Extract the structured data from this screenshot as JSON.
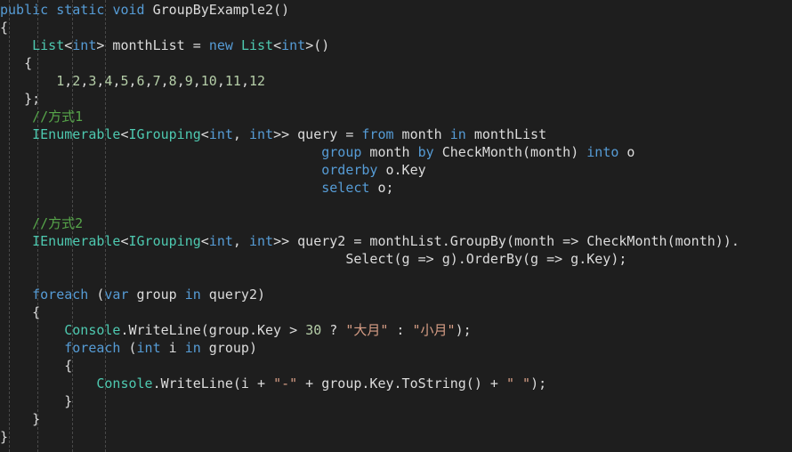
{
  "editor": {
    "background": "#1e1e1e",
    "font_size_px": 15,
    "line_height_px": 20,
    "indent_guide_color": "#5a5a5a",
    "colors": {
      "keyword": "#569cd6",
      "type": "#4ec9b0",
      "plain": "#dcdcdc",
      "number": "#b5cea8",
      "string": "#d69d85",
      "comment": "#57a64a"
    },
    "language": "csharp"
  },
  "code": {
    "lines": [
      [
        {
          "t": "public",
          "c": "kw"
        },
        {
          "t": " ",
          "c": "pln"
        },
        {
          "t": "static",
          "c": "kw"
        },
        {
          "t": " ",
          "c": "pln"
        },
        {
          "t": "void",
          "c": "kw"
        },
        {
          "t": " GroupByExample2()",
          "c": "pln"
        }
      ],
      [
        {
          "t": "{",
          "c": "pln"
        }
      ],
      [
        {
          "t": "    ",
          "c": "pln"
        },
        {
          "t": "List",
          "c": "typ"
        },
        {
          "t": "<",
          "c": "pln"
        },
        {
          "t": "int",
          "c": "kw"
        },
        {
          "t": "> monthList = ",
          "c": "pln"
        },
        {
          "t": "new",
          "c": "kw"
        },
        {
          "t": " ",
          "c": "pln"
        },
        {
          "t": "List",
          "c": "typ"
        },
        {
          "t": "<",
          "c": "pln"
        },
        {
          "t": "int",
          "c": "kw"
        },
        {
          "t": ">()",
          "c": "pln"
        }
      ],
      [
        {
          "t": "   {",
          "c": "pln"
        }
      ],
      [
        {
          "t": "       ",
          "c": "pln"
        },
        {
          "t": "1",
          "c": "num"
        },
        {
          "t": ",",
          "c": "pln"
        },
        {
          "t": "2",
          "c": "num"
        },
        {
          "t": ",",
          "c": "pln"
        },
        {
          "t": "3",
          "c": "num"
        },
        {
          "t": ",",
          "c": "pln"
        },
        {
          "t": "4",
          "c": "num"
        },
        {
          "t": ",",
          "c": "pln"
        },
        {
          "t": "5",
          "c": "num"
        },
        {
          "t": ",",
          "c": "pln"
        },
        {
          "t": "6",
          "c": "num"
        },
        {
          "t": ",",
          "c": "pln"
        },
        {
          "t": "7",
          "c": "num"
        },
        {
          "t": ",",
          "c": "pln"
        },
        {
          "t": "8",
          "c": "num"
        },
        {
          "t": ",",
          "c": "pln"
        },
        {
          "t": "9",
          "c": "num"
        },
        {
          "t": ",",
          "c": "pln"
        },
        {
          "t": "10",
          "c": "num"
        },
        {
          "t": ",",
          "c": "pln"
        },
        {
          "t": "11",
          "c": "num"
        },
        {
          "t": ",",
          "c": "pln"
        },
        {
          "t": "12",
          "c": "num"
        }
      ],
      [
        {
          "t": "   };",
          "c": "pln"
        }
      ],
      [
        {
          "t": "    ",
          "c": "pln"
        },
        {
          "t": "//方式1",
          "c": "cmt"
        }
      ],
      [
        {
          "t": "    ",
          "c": "pln"
        },
        {
          "t": "IEnumerable",
          "c": "typ"
        },
        {
          "t": "<",
          "c": "pln"
        },
        {
          "t": "IGrouping",
          "c": "typ"
        },
        {
          "t": "<",
          "c": "pln"
        },
        {
          "t": "int",
          "c": "kw"
        },
        {
          "t": ", ",
          "c": "pln"
        },
        {
          "t": "int",
          "c": "kw"
        },
        {
          "t": ">> query = ",
          "c": "pln"
        },
        {
          "t": "from",
          "c": "kw"
        },
        {
          "t": " month ",
          "c": "pln"
        },
        {
          "t": "in",
          "c": "kw"
        },
        {
          "t": " monthList",
          "c": "pln"
        }
      ],
      [
        {
          "t": "                                        ",
          "c": "pln"
        },
        {
          "t": "group",
          "c": "kw"
        },
        {
          "t": " month ",
          "c": "pln"
        },
        {
          "t": "by",
          "c": "kw"
        },
        {
          "t": " CheckMonth(month) ",
          "c": "pln"
        },
        {
          "t": "into",
          "c": "kw"
        },
        {
          "t": " o",
          "c": "pln"
        }
      ],
      [
        {
          "t": "                                        ",
          "c": "pln"
        },
        {
          "t": "orderby",
          "c": "kw"
        },
        {
          "t": " o.Key",
          "c": "pln"
        }
      ],
      [
        {
          "t": "                                        ",
          "c": "pln"
        },
        {
          "t": "select",
          "c": "kw"
        },
        {
          "t": " o;",
          "c": "pln"
        }
      ],
      [],
      [
        {
          "t": "    ",
          "c": "pln"
        },
        {
          "t": "//方式2",
          "c": "cmt"
        }
      ],
      [
        {
          "t": "    ",
          "c": "pln"
        },
        {
          "t": "IEnumerable",
          "c": "typ"
        },
        {
          "t": "<",
          "c": "pln"
        },
        {
          "t": "IGrouping",
          "c": "typ"
        },
        {
          "t": "<",
          "c": "pln"
        },
        {
          "t": "int",
          "c": "kw"
        },
        {
          "t": ", ",
          "c": "pln"
        },
        {
          "t": "int",
          "c": "kw"
        },
        {
          "t": ">> query2 = monthList.GroupBy(month => CheckMonth(month)).",
          "c": "pln"
        }
      ],
      [
        {
          "t": "                                           Select(g => g).OrderBy(g => g.Key);",
          "c": "pln"
        }
      ],
      [],
      [
        {
          "t": "    ",
          "c": "pln"
        },
        {
          "t": "foreach",
          "c": "kw"
        },
        {
          "t": " (",
          "c": "pln"
        },
        {
          "t": "var",
          "c": "kw"
        },
        {
          "t": " group ",
          "c": "pln"
        },
        {
          "t": "in",
          "c": "kw"
        },
        {
          "t": " query2)",
          "c": "pln"
        }
      ],
      [
        {
          "t": "    {",
          "c": "pln"
        }
      ],
      [
        {
          "t": "        ",
          "c": "pln"
        },
        {
          "t": "Console",
          "c": "typ"
        },
        {
          "t": ".WriteLine(group.Key > ",
          "c": "pln"
        },
        {
          "t": "30",
          "c": "num"
        },
        {
          "t": " ? ",
          "c": "pln"
        },
        {
          "t": "\"大月\"",
          "c": "str"
        },
        {
          "t": " : ",
          "c": "pln"
        },
        {
          "t": "\"小月\"",
          "c": "str"
        },
        {
          "t": ");",
          "c": "pln"
        }
      ],
      [
        {
          "t": "        ",
          "c": "pln"
        },
        {
          "t": "foreach",
          "c": "kw"
        },
        {
          "t": " (",
          "c": "pln"
        },
        {
          "t": "int",
          "c": "kw"
        },
        {
          "t": " i ",
          "c": "pln"
        },
        {
          "t": "in",
          "c": "kw"
        },
        {
          "t": " group)",
          "c": "pln"
        }
      ],
      [
        {
          "t": "        {",
          "c": "pln"
        }
      ],
      [
        {
          "t": "            ",
          "c": "pln"
        },
        {
          "t": "Console",
          "c": "typ"
        },
        {
          "t": ".WriteLine(i + ",
          "c": "pln"
        },
        {
          "t": "\"-\"",
          "c": "str"
        },
        {
          "t": " + group.Key.ToString() + ",
          "c": "pln"
        },
        {
          "t": "\" \"",
          "c": "str"
        },
        {
          "t": ");",
          "c": "pln"
        }
      ],
      [
        {
          "t": "        }",
          "c": "pln"
        }
      ],
      [
        {
          "t": "    }",
          "c": "pln"
        }
      ],
      [
        {
          "t": "}",
          "c": "pln"
        }
      ]
    ]
  },
  "indent_guides": {
    "x_positions": [
      10,
      42,
      81,
      118
    ]
  }
}
